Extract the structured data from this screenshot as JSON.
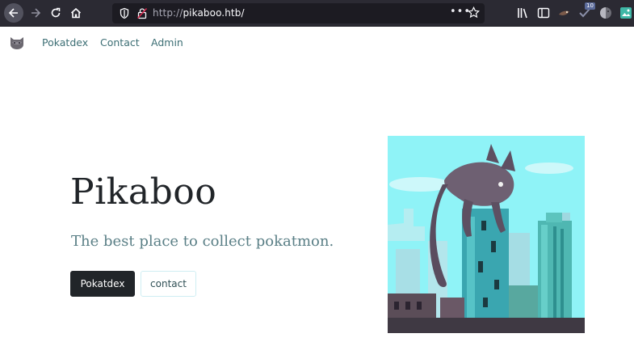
{
  "browser": {
    "url_scheme": "http://",
    "url_host": "pikaboo.htb/",
    "ext_badge": "10",
    "icons": {
      "back": "arrow-left-icon",
      "forward": "arrow-right-icon",
      "reload": "reload-icon",
      "home": "home-icon",
      "page_actions": "more-dots-icon",
      "bookmark": "star-icon",
      "library": "library-icon",
      "sidebar": "sidebar-icon"
    }
  },
  "nav": {
    "links": [
      "Pokatdex",
      "Contact",
      "Admin"
    ]
  },
  "hero": {
    "title": "Pikaboo",
    "subtitle": "The best place to collect pokatmon.",
    "primary_button": "Pokatdex",
    "secondary_button": "contact"
  },
  "colors": {
    "chrome_bg": "#2b2a33",
    "url_bg": "#1c1b22",
    "link": "#3c6e74",
    "subtitle": "#5a7f86",
    "button_dark": "#212529",
    "art_sky": "#8ff3f7"
  }
}
